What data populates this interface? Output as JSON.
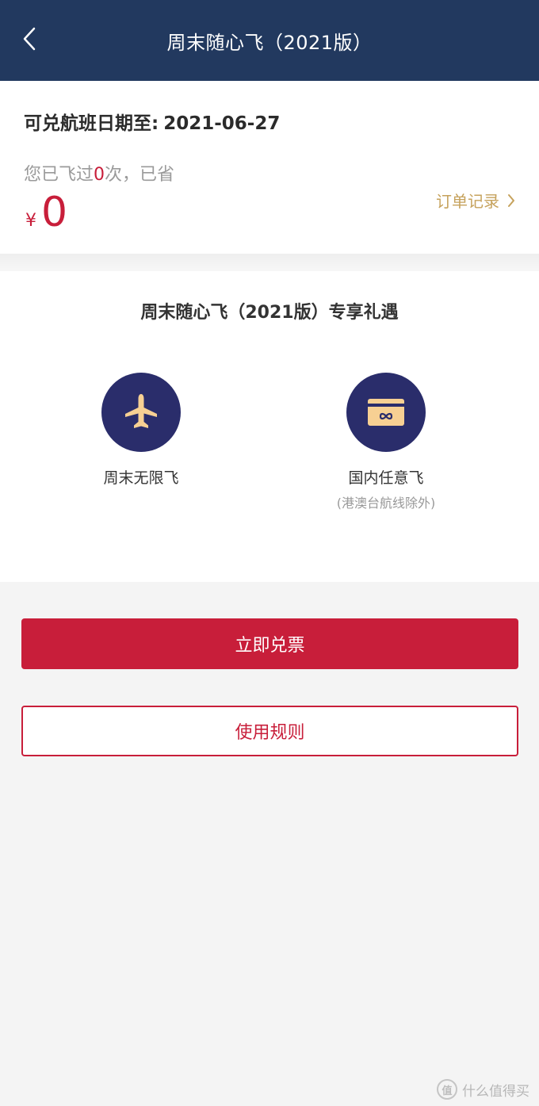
{
  "colors": {
    "navbar": "#22395f",
    "accent_red": "#c81e3a",
    "gold": "#c6a25c",
    "icon_circle": "#2a2d6b",
    "background": "#f4f4f4"
  },
  "navbar": {
    "back_icon": "chevron-left-icon",
    "title": "周末随心飞（2021版）"
  },
  "summary": {
    "valid_label": "可兑航班日期至:",
    "valid_date": "2021-06-27",
    "flown_prefix": "您已飞过",
    "flown_count": "0",
    "flown_suffix": "次，已省",
    "currency": "¥",
    "saved_amount": "0",
    "orders_link": "订单记录",
    "orders_icon": "chevron-right-icon"
  },
  "benefits": {
    "title": "周末随心飞（2021版）专享礼遇",
    "items": [
      {
        "icon": "airplane-icon",
        "label": "周末无限飞",
        "note": ""
      },
      {
        "icon": "infinity-card-icon",
        "label": "国内任意飞",
        "note": "(港澳台航线除外)"
      }
    ]
  },
  "actions": {
    "redeem": "立即兑票",
    "rules": "使用规则"
  },
  "watermark": {
    "badge": "值",
    "text": "什么值得买"
  }
}
